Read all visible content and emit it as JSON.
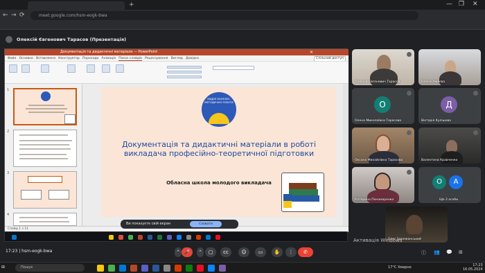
{
  "browser": {
    "tab_title": "",
    "url": "meet.google.com/hsm-eogk-bwa",
    "window_controls": [
      "—",
      "❐",
      "✕"
    ],
    "nav": [
      "←",
      "→",
      "⟳"
    ]
  },
  "meeting": {
    "header_name": "Олексій Євгенович Тарасов (Презентація)",
    "code_time": "17:23",
    "code": "hsm-eogk-bwa"
  },
  "ppt": {
    "title_bar": "Документація та дидактичні матеріали — PowerPoint",
    "ribbon_tabs": [
      "Файл",
      "Основне",
      "Вставлення",
      "Конструктор",
      "Переходи",
      "Анімація",
      "Показ слайдів",
      "Рецензування",
      "Вигляд",
      "Довідка"
    ],
    "share_label": "Спільний доступ",
    "status": "Слайд 1 з 11",
    "thumbs": [
      "1",
      "2",
      "3",
      "4"
    ]
  },
  "slide": {
    "logo_text": "ВІДДІЛ НАУКОВО-МЕТОДИЧНОЇ РОБОТИ",
    "title": "Документація та дидактичні матеріали в роботі викладача професійно-теоретичної підготовки",
    "subtitle": "Обласна школа молодого викладача"
  },
  "share_bar": {
    "text": "Ви показуєте свій екран",
    "hide_label": "Сховати"
  },
  "participants": [
    {
      "name": "Олексій Євгенович Тарасов",
      "kind": "video"
    },
    {
      "name": "Олена Ажаєва",
      "kind": "video"
    },
    {
      "name": "Олена Миколаївна Тарасова",
      "kind": "avatar",
      "letter": "О",
      "color": "#137e73"
    },
    {
      "name": "Вікторія Кулішова",
      "kind": "avatar",
      "letter": "Д",
      "color": "#7b5ea7"
    },
    {
      "name": "Оксана Михайлівна Тарасова",
      "kind": "video"
    },
    {
      "name": "Валентина Кравченко",
      "kind": "video"
    },
    {
      "name": "Катерина Пономаренко",
      "kind": "video"
    },
    {
      "name": "Ще 2 особи",
      "kind": "group",
      "letters": [
        "О",
        "А"
      ]
    },
    {
      "name": "Олег Бережанський",
      "kind": "video"
    }
  ],
  "activation": {
    "line1": "Активація Windows",
    "line2": "Щоб активувати Windows, перейдіть до розділу \"Параметри\"."
  },
  "controls": [
    "⌃",
    "🎤",
    "⌃",
    "▭",
    "✋",
    "⋮",
    "✆"
  ],
  "taskbar": {
    "search": "Пошук",
    "tray": "17°C Хмарно",
    "time": "17:23",
    "date": "16.05.2024"
  },
  "colors": {
    "slide_bg": "#fbe5d6",
    "title_blue": "#1f4aa0",
    "ppt_red": "#b7472a"
  }
}
